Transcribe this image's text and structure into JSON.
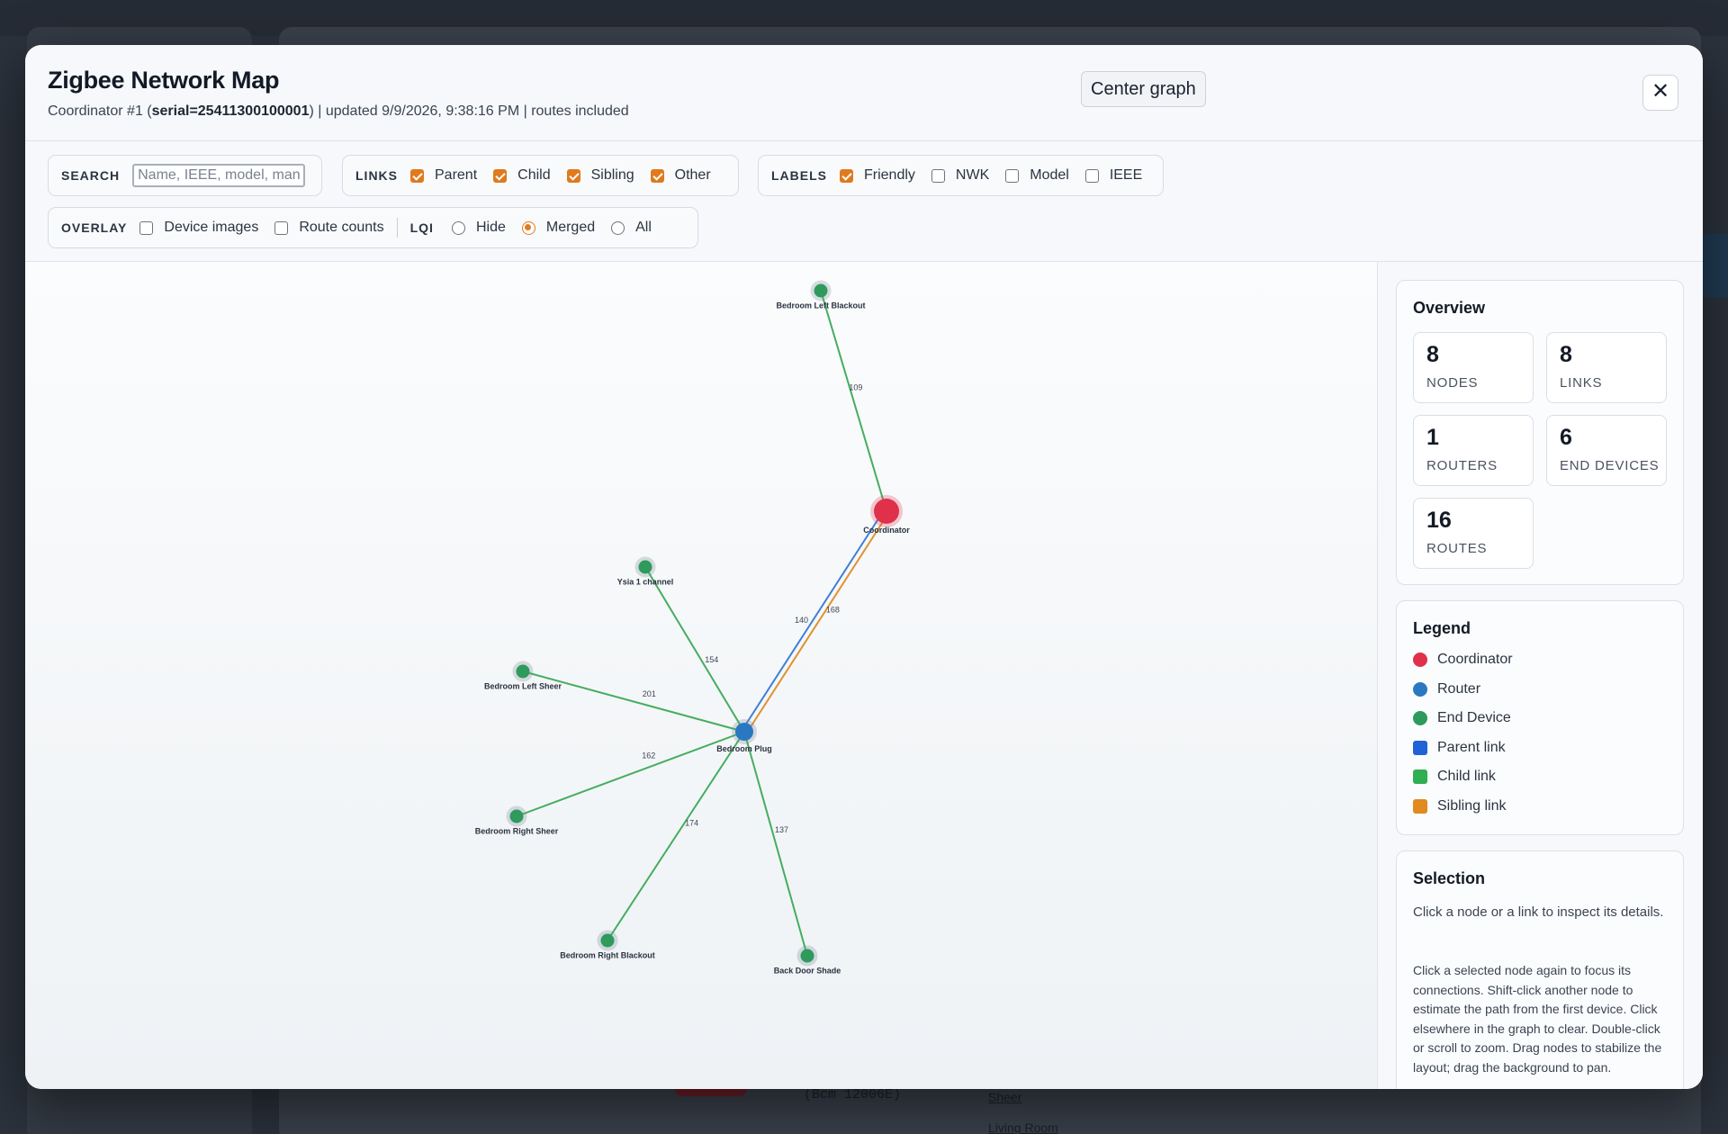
{
  "modal": {
    "title": "Zigbee Network Map",
    "subtitle_prefix": "Coordinator #1 (",
    "subtitle_serial": "serial=25411300100001",
    "subtitle_suffix": ") | updated 9/9/2026, 9:38:16 PM | routes included",
    "center_button": "Center graph",
    "close_icon": "close-icon"
  },
  "toolbar": {
    "search": {
      "label": "SEARCH",
      "placeholder": "Name, IEEE, model, manufacturer",
      "value": ""
    },
    "links": {
      "label": "LINKS",
      "options": [
        {
          "label": "Parent",
          "checked": true
        },
        {
          "label": "Child",
          "checked": true
        },
        {
          "label": "Sibling",
          "checked": true
        },
        {
          "label": "Other",
          "checked": true
        }
      ]
    },
    "labels": {
      "label": "LABELS",
      "options": [
        {
          "label": "Friendly",
          "checked": true
        },
        {
          "label": "NWK",
          "checked": false
        },
        {
          "label": "Model",
          "checked": false
        },
        {
          "label": "IEEE",
          "checked": false
        }
      ]
    },
    "overlay": {
      "label": "OVERLAY",
      "options": [
        {
          "label": "Device images",
          "checked": false
        },
        {
          "label": "Route counts",
          "checked": false
        }
      ],
      "lqi_label": "LQI",
      "lqi_options": [
        {
          "label": "Hide",
          "selected": false
        },
        {
          "label": "Merged",
          "selected": true
        },
        {
          "label": "All",
          "selected": false
        }
      ]
    }
  },
  "graph": {
    "nodes": [
      {
        "id": "coordinator",
        "label": "Coordinator",
        "type": "coordinator"
      },
      {
        "id": "bedroom-plug",
        "label": "Bedroom Plug",
        "type": "router"
      },
      {
        "id": "bedroom-left-blackout",
        "label": "Bedroom Left Blackout",
        "type": "end"
      },
      {
        "id": "ysia",
        "label": "Ysia 1 channel",
        "type": "end"
      },
      {
        "id": "bedroom-left-sheer",
        "label": "Bedroom Left Sheer",
        "type": "end"
      },
      {
        "id": "bedroom-right-sheer",
        "label": "Bedroom Right Sheer",
        "type": "end"
      },
      {
        "id": "bedroom-right-blackout",
        "label": "Bedroom Right Blackout",
        "type": "end"
      },
      {
        "id": "back-door-shade",
        "label": "Back Door Shade",
        "type": "end"
      }
    ],
    "edges": [
      {
        "from": "coordinator",
        "to": "bedroom-left-blackout",
        "kind": "child",
        "lqi": "109"
      },
      {
        "from": "coordinator",
        "to": "bedroom-plug",
        "kind": "sibling",
        "lqi": "140"
      },
      {
        "from": "coordinator",
        "to": "bedroom-plug",
        "kind": "parent",
        "lqi": "168"
      },
      {
        "from": "bedroom-plug",
        "to": "ysia",
        "kind": "child",
        "lqi": "154"
      },
      {
        "from": "bedroom-plug",
        "to": "bedroom-left-sheer",
        "kind": "child",
        "lqi": "201"
      },
      {
        "from": "bedroom-plug",
        "to": "bedroom-right-sheer",
        "kind": "child",
        "lqi": "162"
      },
      {
        "from": "bedroom-plug",
        "to": "bedroom-right-blackout",
        "kind": "child",
        "lqi": "174"
      },
      {
        "from": "bedroom-plug",
        "to": "back-door-shade",
        "kind": "child",
        "lqi": "137"
      }
    ],
    "colors": {
      "coordinator": "#e0304a",
      "router": "#2a78c2",
      "end": "#2e9a5c",
      "parent": "#3a7bd5",
      "child": "#3aad5e",
      "sibling": "#e08a2a"
    }
  },
  "sidebar": {
    "overview": {
      "title": "Overview",
      "stats": [
        {
          "value": "8",
          "label": "Nodes"
        },
        {
          "value": "8",
          "label": "Links"
        },
        {
          "value": "1",
          "label": "Routers"
        },
        {
          "value": "6",
          "label": "End devices"
        },
        {
          "value": "16",
          "label": "Routes"
        }
      ]
    },
    "legend": {
      "title": "Legend",
      "items": [
        {
          "label": "Coordinator",
          "shape": "dot",
          "color": "#e0304a"
        },
        {
          "label": "Router",
          "shape": "dot",
          "color": "#2a78c2"
        },
        {
          "label": "End Device",
          "shape": "dot",
          "color": "#2e9a5c"
        },
        {
          "label": "Parent link",
          "shape": "square",
          "color": "#1f63d6"
        },
        {
          "label": "Child link",
          "shape": "square",
          "color": "#2fae52"
        },
        {
          "label": "Sibling link",
          "shape": "square",
          "color": "#e08a1f"
        }
      ]
    },
    "selection": {
      "title": "Selection",
      "hint": "Click a node or a link to inspect its details.",
      "help": "Click a selected node again to focus its connections. Shift-click another node to estimate the path from the first device. Click elsewhere in the graph to clear. Double-click or scroll to zoom. Drag nodes to stabilize the layout; drag the background to pan."
    }
  },
  "background": {
    "text_sheer": "Sheer",
    "text_living_room": "Living Room",
    "text_code": "(Bcm 12006E)"
  }
}
